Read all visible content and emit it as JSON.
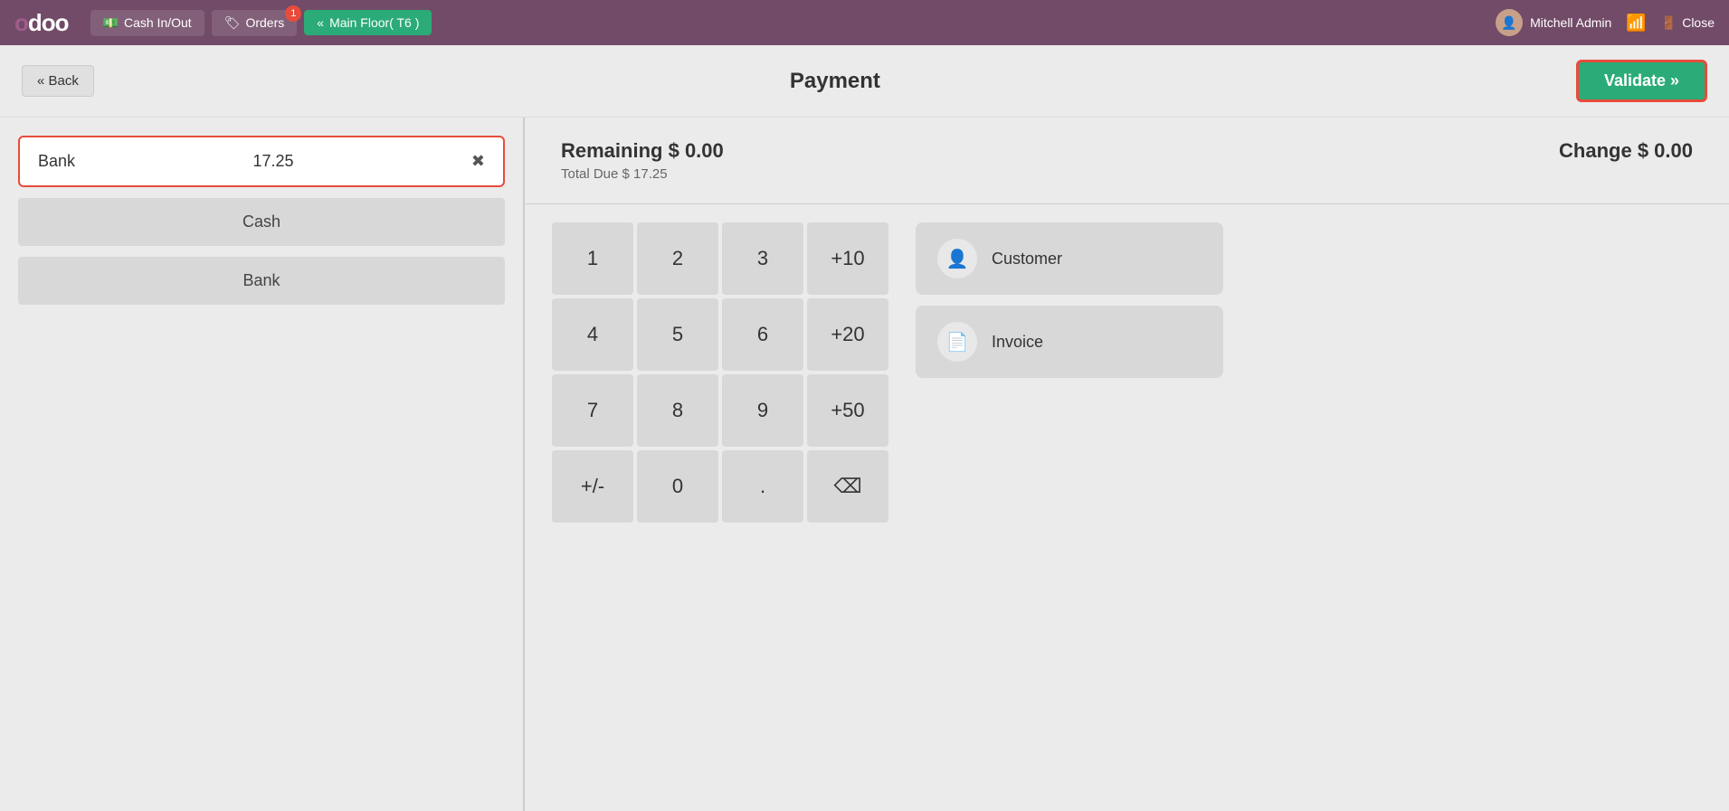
{
  "topnav": {
    "logo": "odoo",
    "cash_inout_label": "Cash In/Out",
    "orders_label": "Orders",
    "orders_badge": "1",
    "floor_label": "Main Floor( T6 )",
    "user_name": "Mitchell Admin",
    "close_label": "Close",
    "wifi_signal": "strong"
  },
  "header": {
    "back_label": "« Back",
    "title": "Payment",
    "validate_label": "Validate »"
  },
  "payment": {
    "selected_method": "Bank",
    "selected_amount": "17.25",
    "payment_methods": [
      "Cash",
      "Bank"
    ],
    "remaining_label": "Remaining",
    "remaining_amount": "$ 0.00",
    "total_due_label": "Total Due",
    "total_due_amount": "$ 17.25",
    "change_label": "Change",
    "change_amount": "$ 0.00"
  },
  "numpad": {
    "keys": [
      "1",
      "2",
      "3",
      "+10",
      "4",
      "5",
      "6",
      "+20",
      "7",
      "8",
      "9",
      "+50",
      "+/-",
      "0",
      ".",
      "⌫"
    ]
  },
  "actions": {
    "customer_label": "Customer",
    "invoice_label": "Invoice"
  }
}
